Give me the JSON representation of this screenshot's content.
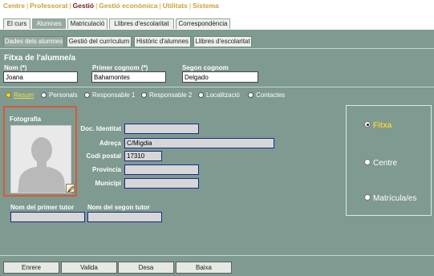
{
  "topnav": {
    "items": [
      {
        "label": "Centre",
        "active": false
      },
      {
        "label": "Professorat",
        "active": false
      },
      {
        "label": "Gestió",
        "active": true
      },
      {
        "label": "Gestió econòmica",
        "active": false
      },
      {
        "label": "Utilitats",
        "active": false
      },
      {
        "label": "Sistema",
        "active": false
      }
    ],
    "separator": "|"
  },
  "main_tabs": [
    {
      "label": "El curs",
      "active": false
    },
    {
      "label": "Alumnes",
      "active": true
    },
    {
      "label": "Matriculació",
      "active": false
    },
    {
      "label": "Llibres d'escolaritat",
      "active": false
    },
    {
      "label": "Correspondència",
      "active": false
    }
  ],
  "sub_tabs": [
    {
      "label": "Dades dels alumnes",
      "active": true
    },
    {
      "label": "Gestió del currículum",
      "active": false
    },
    {
      "label": "Històric d'alumnes",
      "active": false
    },
    {
      "label": "Llibres d'escolaritat",
      "active": false
    }
  ],
  "header": {
    "title": "Fitxa de l'alumne/a",
    "nom_label": "Nom (*)",
    "nom_value": "Joana",
    "cognom1_label": "Primer cognom (*)",
    "cognom1_value": "Bahamontes",
    "cognom2_label": "Segon cognom",
    "cognom2_value": "Delgado"
  },
  "section_radios": [
    {
      "label": "Resum",
      "active": true
    },
    {
      "label": "Personals",
      "active": false
    },
    {
      "label": "Responsable 1",
      "active": false
    },
    {
      "label": "Responsable 2",
      "active": false
    },
    {
      "label": "Localització",
      "active": false
    },
    {
      "label": "Contactes",
      "active": false
    }
  ],
  "photo": {
    "label": "Fotografia",
    "edit_icon": "pencil-icon"
  },
  "fields": {
    "doc_label": "Doc. Identitat",
    "doc_value": "",
    "adreca_label": "Adreça",
    "adreca_value": "C/Migdia",
    "cp_label": "Codi postal",
    "cp_value": "17310",
    "provincia_label": "Província",
    "provincia_value": "",
    "municipi_label": "Municipi",
    "municipi_value": "",
    "tutor1_label": "Nom del primer tutor",
    "tutor1_value": "",
    "tutor2_label": "Nom del segon tutor",
    "tutor2_value": ""
  },
  "right_panel": [
    {
      "label": "Fitxa",
      "active": true
    },
    {
      "label": "Centre",
      "active": false
    },
    {
      "label": "Matrícula/es",
      "active": false
    }
  ],
  "buttons": {
    "enrere": "Enrere",
    "valida": "Valida",
    "desa": "Desa",
    "baixa": "Baixa"
  },
  "colors": {
    "panel": "#7f9a90",
    "nav_link": "#c9a23a",
    "nav_active": "#7a1a14",
    "highlight": "#f1d23a",
    "photo_border": "#d65a36"
  }
}
